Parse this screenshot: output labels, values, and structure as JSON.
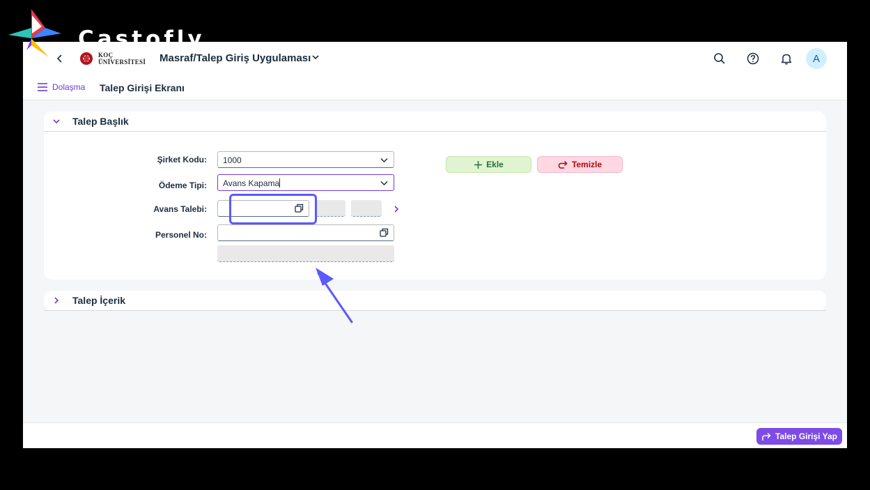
{
  "watermark": {
    "brand": "Castofly"
  },
  "shellbar": {
    "app_title": "Masraf/Talep Giriş Uygulaması",
    "logo_line1": "KOÇ",
    "logo_line2": "ÜNİVERSİTESİ",
    "avatar_initial": "A"
  },
  "subbar": {
    "nav_label": "Dolaşma",
    "page_title": "Talep Girişi Ekranı"
  },
  "header_panel": {
    "title": "Talep Başlık",
    "fields": {
      "sirket_kodu": {
        "label": "Şirket Kodu:",
        "value": "1000"
      },
      "odeme_tipi": {
        "label": "Ödeme Tipi:",
        "value": "Avans Kapama"
      },
      "avans_talebi": {
        "label": "Avans Talebi:",
        "value": ""
      },
      "personel_no": {
        "label": "Personel No:",
        "value": ""
      }
    },
    "buttons": {
      "add": "Ekle",
      "clear": "Temizle"
    }
  },
  "content_panel": {
    "title": "Talep İçerik"
  },
  "footer": {
    "submit_label": "Talep Girişi Yap"
  },
  "colors": {
    "accent": "#6b3bd8",
    "highlight": "#5a5aff",
    "add_bg": "#e1f4d1",
    "clear_bg": "#ffd8e4",
    "submit_bg": "#7d4be6"
  }
}
